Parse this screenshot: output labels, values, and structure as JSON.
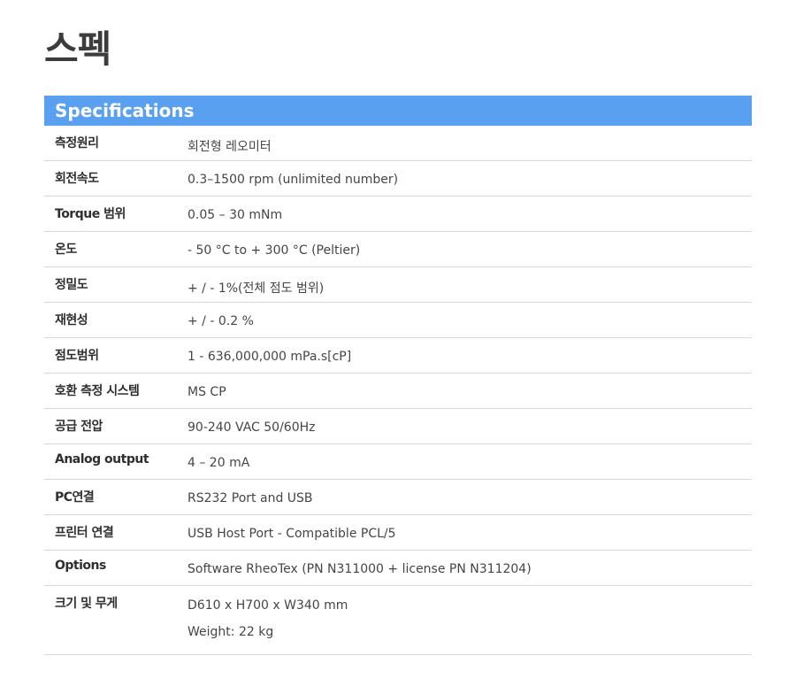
{
  "page_title": "스펙",
  "specs": {
    "header": "Specifications",
    "rows": [
      {
        "label": "측정원리",
        "values": [
          "회전형 레오미터"
        ]
      },
      {
        "label": "회전속도",
        "values": [
          "0.3–1500 rpm (unlimited number)"
        ]
      },
      {
        "label": "Torque 범위",
        "values": [
          "0.05 – 30 mNm"
        ]
      },
      {
        "label": "온도",
        "values": [
          "- 50 °C to + 300 °C (Peltier)"
        ]
      },
      {
        "label": "정밀도",
        "values": [
          "+ / - 1%(전체 점도 범위)"
        ]
      },
      {
        "label": "재현성",
        "values": [
          "+ / - 0.2 %"
        ]
      },
      {
        "label": "점도범위",
        "values": [
          "1 - 636,000,000 mPa.s[cP]"
        ]
      },
      {
        "label": "호환 측정 시스템",
        "values": [
          "MS CP"
        ]
      },
      {
        "label": "공급 전압",
        "values": [
          "90-240 VAC 50/60Hz"
        ]
      },
      {
        "label": "Analog output",
        "values": [
          "4 – 20 mA"
        ]
      },
      {
        "label": "PC연결",
        "values": [
          "RS232 Port and USB"
        ]
      },
      {
        "label": "프린터 연결",
        "values": [
          "USB Host Port - Compatible PCL/5"
        ]
      },
      {
        "label": "Options",
        "values": [
          "Software RheoTex (PN N311000 + license PN N311204)"
        ]
      },
      {
        "label": "크기 및 무게",
        "values": [
          "D610 x H700 x W340 mm",
          "Weight: 22 kg"
        ]
      }
    ]
  }
}
